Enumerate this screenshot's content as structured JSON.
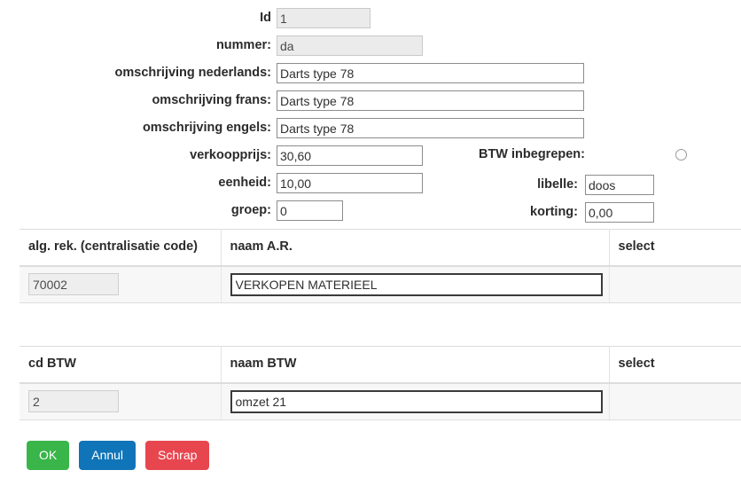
{
  "form": {
    "rows": [
      {
        "label": "Id",
        "value": "1",
        "readonly": true,
        "width": "w-id"
      },
      {
        "label": "nummer:",
        "value": "da",
        "readonly": true,
        "width": "w-med"
      },
      {
        "label": "omschrijving nederlands:",
        "value": "Darts type 78",
        "readonly": false,
        "width": "w-wide"
      },
      {
        "label": "omschrijving frans:",
        "value": "Darts type 78",
        "readonly": false,
        "width": "w-wide"
      },
      {
        "label": "omschrijving engels:",
        "value": "Darts type 78",
        "readonly": false,
        "width": "w-wide"
      },
      {
        "label": "verkoopprijs:",
        "value": "30,60",
        "readonly": false,
        "width": "w-med"
      },
      {
        "label": "eenheid:",
        "value": "10,00",
        "readonly": false,
        "width": "w-med"
      },
      {
        "label": "groep:",
        "value": "0",
        "readonly": false,
        "width": "w-small"
      }
    ],
    "btw_included": {
      "label": "BTW inbegrepen:",
      "icon": "radio-unchecked-icon",
      "checked": false
    },
    "libelle": {
      "label": "libelle:",
      "value": "doos"
    },
    "korting": {
      "label": "korting:",
      "value": "0,00"
    }
  },
  "table_ar": {
    "headers": [
      "alg. rek. (centralisatie code)",
      "naam A.R.",
      "select"
    ],
    "rows": [
      {
        "code": "70002",
        "name": "VERKOPEN MATERIEEL",
        "select": ""
      }
    ]
  },
  "table_btw": {
    "headers": [
      "cd BTW",
      "naam BTW",
      "select"
    ],
    "rows": [
      {
        "code": "2",
        "name": "omzet 21",
        "select": ""
      }
    ]
  },
  "buttons": {
    "ok": "OK",
    "cancel": "Annul",
    "delete": "Schrap"
  },
  "colors": {
    "ok": "#39b54a",
    "cancel": "#1074b8",
    "delete": "#e8464f"
  }
}
